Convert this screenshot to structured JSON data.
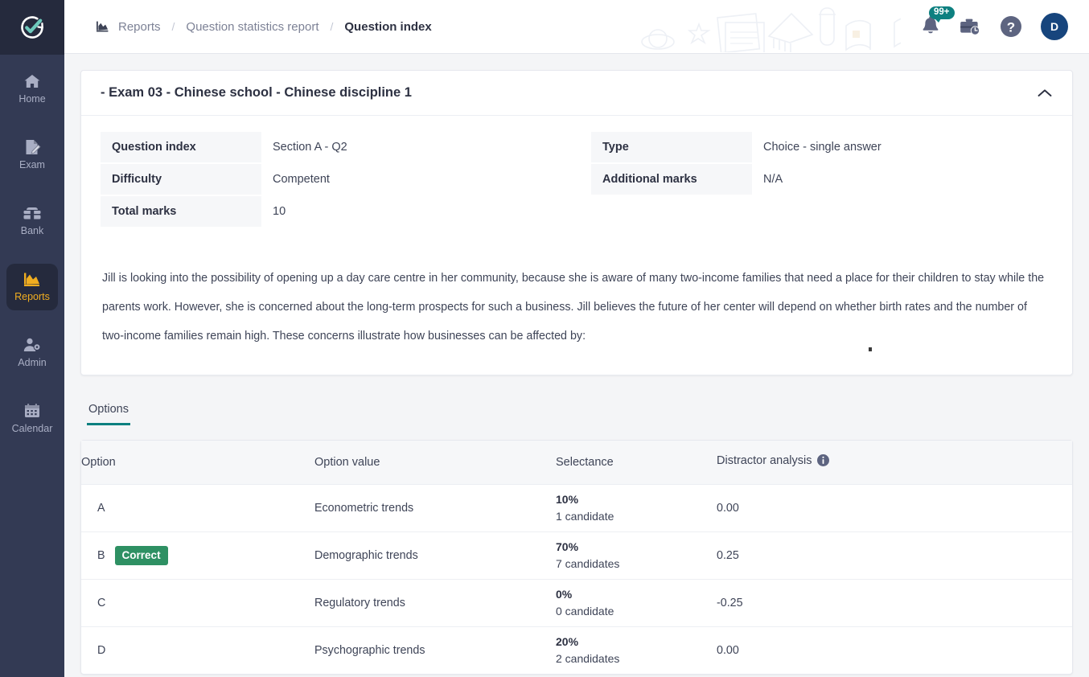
{
  "brand": {
    "logo_icon": "check-circle-refresh-logo",
    "sidebar_bg": "#333a54",
    "accent_teal": "#0d8080",
    "accent_active": "#f0ad20",
    "correct_green": "#2e9063"
  },
  "sidebar": {
    "items": [
      {
        "label": "Home",
        "icon": "home-icon",
        "active": false
      },
      {
        "label": "Exam",
        "icon": "exam-icon",
        "active": false
      },
      {
        "label": "Bank",
        "icon": "bank-icon",
        "active": false
      },
      {
        "label": "Reports",
        "icon": "reports-icon",
        "active": true
      },
      {
        "label": "Admin",
        "icon": "admin-user-gear-icon",
        "active": false
      },
      {
        "label": "Calendar",
        "icon": "calendar-icon",
        "active": false
      }
    ]
  },
  "header": {
    "breadcrumb_icon": "chart-report-icon",
    "breadcrumb": [
      {
        "label": "Reports",
        "current": false
      },
      {
        "label": "Question statistics report",
        "current": false
      },
      {
        "label": "Question index",
        "current": true
      }
    ],
    "separator": "/",
    "notifications": {
      "icon": "bell-icon",
      "badge": "99+"
    },
    "tasks": {
      "icon": "briefcase-clock-icon"
    },
    "help": {
      "icon": "help-question-icon"
    },
    "avatar": {
      "initial": "D",
      "name": "user-avatar"
    }
  },
  "question_card": {
    "title": "- Exam 03 - Chinese school - Chinese discipline 1",
    "collapse_icon": "chevron-up-icon",
    "info_left": [
      {
        "key": "Question index",
        "value": "Section A - Q2"
      },
      {
        "key": "Difficulty",
        "value": "Competent"
      },
      {
        "key": "Total marks",
        "value": "10"
      }
    ],
    "info_right": [
      {
        "key": "Type",
        "value": "Choice - single answer"
      },
      {
        "key": "Additional marks",
        "value": "N/A"
      }
    ],
    "question_text": "Jill is looking into the possibility of opening up a day care centre in her community, because she is aware of many two-income families that need a place for their children to stay while the parents work. However, she is concerned about the long-term prospects for such a business. Jill believes the future of her center will depend on whether birth rates and the number of two-income families remain high. These concerns illustrate how businesses can be affected by:"
  },
  "tabs": [
    {
      "label": "Options",
      "active": true
    }
  ],
  "options_table": {
    "columns": [
      "Option",
      "Option value",
      "Selectance",
      "Distractor analysis"
    ],
    "distractor_info_icon": "info-icon",
    "rows": [
      {
        "option": "A",
        "badge": "",
        "value": "Econometric trends",
        "selectance_pct": "10%",
        "selectance_count": "1 candidate",
        "distractor": "0.00"
      },
      {
        "option": "B",
        "badge": "Correct",
        "value": "Demographic trends",
        "selectance_pct": "70%",
        "selectance_count": "7 candidates",
        "distractor": "0.25"
      },
      {
        "option": "C",
        "badge": "",
        "value": "Regulatory trends",
        "selectance_pct": "0%",
        "selectance_count": "0 candidate",
        "distractor": "-0.25"
      },
      {
        "option": "D",
        "badge": "",
        "value": "Psychographic trends",
        "selectance_pct": "20%",
        "selectance_count": "2 candidates",
        "distractor": "0.00"
      }
    ]
  }
}
